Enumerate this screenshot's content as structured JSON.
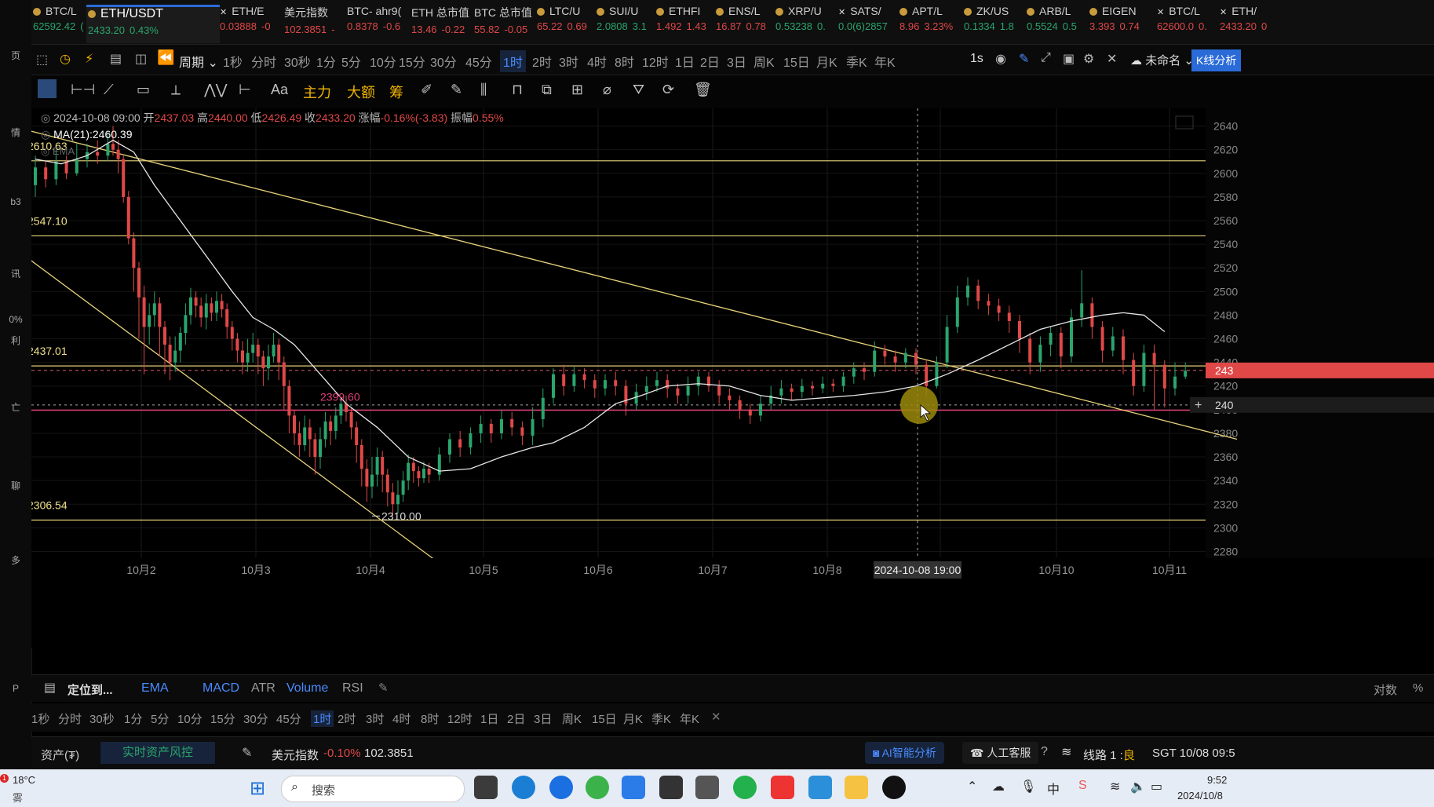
{
  "left_strip": [
    {
      "label": "页",
      "y": 62
    },
    {
      "label": "情",
      "y": 160
    },
    {
      "label": "b3",
      "y": 250
    },
    {
      "label": "讯",
      "y": 340
    },
    {
      "label": "0%",
      "y": 400
    },
    {
      "label": "利",
      "y": 425
    },
    {
      "label": "亡",
      "y": 510
    },
    {
      "label": "聊",
      "y": 610
    },
    {
      "label": "多",
      "y": 705
    },
    {
      "label": "P",
      "y": 870
    }
  ],
  "tickers": [
    {
      "name": "BTC/L",
      "price": "62592.42",
      "change": "(",
      "color": "#2aa56d",
      "icon": "coin-icon"
    },
    {
      "name": "ETH/USDT",
      "price": "2433.20",
      "change": "0.43%",
      "color": "#2aa56d",
      "icon": "coin-icon",
      "active": true
    },
    {
      "name": "ETH/E",
      "price": "0.03888",
      "change": "-0",
      "color": "#e04848",
      "icon": "close-icon"
    },
    {
      "name": "美元指数",
      "price": "102.3851",
      "change": "-",
      "color": "#e04848",
      "icon": ""
    },
    {
      "name": "BTC- ahr9(",
      "price": "0.8378",
      "change": "-0.6",
      "color": "#e04848",
      "icon": ""
    },
    {
      "name": "ETH 总市值",
      "price": "13.46",
      "change": "-0.22",
      "color": "#e04848",
      "icon": ""
    },
    {
      "name": "BTC 总市值",
      "price": "55.82",
      "change": "-0.05",
      "color": "#e04848",
      "icon": ""
    },
    {
      "name": "LTC/U",
      "price": "65.22",
      "change": "0.69",
      "color": "#e04848",
      "icon": "coin-icon"
    },
    {
      "name": "SUI/U",
      "price": "2.0808",
      "change": "3.1",
      "color": "#2aa56d",
      "icon": "coin-icon"
    },
    {
      "name": "ETHFI",
      "price": "1.492",
      "change": "1.43",
      "color": "#e04848",
      "icon": "coin-icon"
    },
    {
      "name": "ENS/L",
      "price": "16.87",
      "change": "0.78",
      "color": "#e04848",
      "icon": "coin-icon"
    },
    {
      "name": "XRP/U",
      "price": "0.53238",
      "change": "0.",
      "color": "#2aa56d",
      "icon": "xrp-icon"
    },
    {
      "name": "SATS/",
      "price": "0.0(6)2857",
      "change": "",
      "color": "#2aa56d",
      "icon": "close-icon"
    },
    {
      "name": "APT/L",
      "price": "8.96",
      "change": "3.23%",
      "color": "#e04848",
      "icon": "coin-icon"
    },
    {
      "name": "ZK/US",
      "price": "0.1334",
      "change": "1.8",
      "color": "#2aa56d",
      "icon": "coin-icon"
    },
    {
      "name": "ARB/L",
      "price": "0.5524",
      "change": "0.5",
      "color": "#2aa56d",
      "icon": "coin-icon"
    },
    {
      "name": "EIGEN",
      "price": "3.393",
      "change": "0.74",
      "color": "#e04848",
      "icon": "coin-icon"
    },
    {
      "name": "BTC/L",
      "price": "62600.0",
      "change": "0.",
      "color": "#e04848",
      "icon": "close-icon"
    },
    {
      "name": "ETH/",
      "price": "2433.20",
      "change": "0",
      "color": "#e04848",
      "icon": "close-icon"
    }
  ],
  "period_bar": {
    "cycle_label": "周期",
    "periods": [
      "1秒",
      "分时",
      "30秒",
      "1分",
      "5分",
      "10分",
      "15分",
      "30分",
      "45分",
      "1时",
      "2时",
      "3时",
      "4时",
      "8时",
      "12时",
      "1日",
      "2日",
      "3日",
      "周K",
      "15日",
      "月K",
      "季K",
      "年K"
    ],
    "selected": "1时",
    "interval": "1s",
    "workspace": "未命名",
    "k_analysis": "K线分析"
  },
  "draw_bar": {
    "text_tool": "Aa",
    "main": "主力",
    "big": "大额",
    "chip": "筹"
  },
  "info": {
    "date": "2024-10-08 09:00",
    "open_label": "开",
    "open": "2437.03",
    "high_label": "高",
    "high": "2440.00",
    "low_label": "低",
    "low": "2426.49",
    "close_label": "收",
    "close": "2433.20",
    "change_label": "涨幅",
    "change": "-0.16%(-3.83)",
    "amp_label": "振幅",
    "amp": "0.55%",
    "ma_label": "MA(21):2460.39",
    "ema_label": "EMA"
  },
  "chart_data": {
    "type": "candlestick",
    "x_ticks": [
      "10月2",
      "10月3",
      "10月4",
      "10月5",
      "10月6",
      "10月7",
      "10月8",
      "10月10",
      "10月11"
    ],
    "y_ticks": [
      2640,
      2620,
      2600,
      2580,
      2560,
      2540,
      2520,
      2500,
      2480,
      2460,
      2440,
      2420,
      2400,
      2380,
      2360,
      2340,
      2320,
      2300,
      2280
    ],
    "ylim": [
      2270,
      2655
    ],
    "crosshair_label": "2024-10-08 19:00",
    "current_price_tag": "243",
    "crosshair_price_tag": "240",
    "levels": [
      {
        "value": 2610.63,
        "label": "2610.63"
      },
      {
        "value": 2547.1,
        "label": "2547.10"
      },
      {
        "value": 2437.01,
        "label": "2437.01"
      },
      {
        "value": 2306.54,
        "label": "2306.54"
      }
    ],
    "pink_level": {
      "value": 2399.6,
      "label": "2399.60"
    },
    "low_marker": {
      "value": 2310.0,
      "label": "2310.00"
    },
    "ma_points": [
      [
        0,
        2612
      ],
      [
        5,
        2608
      ],
      [
        10,
        2615
      ],
      [
        15,
        2628
      ],
      [
        19,
        2618
      ],
      [
        23,
        2590
      ],
      [
        28,
        2560
      ],
      [
        33,
        2530
      ],
      [
        38,
        2500
      ],
      [
        42,
        2478
      ],
      [
        46,
        2468
      ],
      [
        50,
        2455
      ],
      [
        55,
        2430
      ],
      [
        60,
        2405
      ],
      [
        66,
        2385
      ],
      [
        72,
        2360
      ],
      [
        78,
        2348
      ],
      [
        84,
        2350
      ],
      [
        90,
        2360
      ],
      [
        96,
        2368
      ],
      [
        100,
        2372
      ],
      [
        106,
        2385
      ],
      [
        112,
        2405
      ],
      [
        117,
        2412
      ],
      [
        122,
        2420
      ],
      [
        128,
        2422
      ],
      [
        134,
        2420
      ],
      [
        140,
        2412
      ],
      [
        146,
        2408
      ],
      [
        152,
        2410
      ],
      [
        158,
        2412
      ],
      [
        164,
        2415
      ],
      [
        170,
        2420
      ],
      [
        176,
        2430
      ],
      [
        182,
        2442
      ],
      [
        188,
        2455
      ],
      [
        194,
        2468
      ],
      [
        200,
        2475
      ],
      [
        206,
        2480
      ],
      [
        210,
        2482
      ],
      [
        214,
        2480
      ],
      [
        218,
        2466
      ]
    ],
    "candles": [
      [
        0,
        2590,
        2605,
        2615,
        2580
      ],
      [
        2,
        2605,
        2595,
        2610,
        2588
      ],
      [
        4,
        2595,
        2610,
        2620,
        2590
      ],
      [
        6,
        2610,
        2600,
        2615,
        2595
      ],
      [
        8,
        2600,
        2612,
        2625,
        2598
      ],
      [
        10,
        2612,
        2618,
        2625,
        2605
      ],
      [
        12,
        2618,
        2615,
        2628,
        2608
      ],
      [
        14,
        2615,
        2625,
        2635,
        2610
      ],
      [
        15,
        2625,
        2620,
        2640,
        2615
      ],
      [
        16,
        2620,
        2612,
        2628,
        2600
      ],
      [
        17,
        2612,
        2580,
        2615,
        2575
      ],
      [
        18,
        2580,
        2545,
        2585,
        2540
      ],
      [
        19,
        2545,
        2520,
        2550,
        2500
      ],
      [
        20,
        2520,
        2495,
        2525,
        2460
      ],
      [
        21,
        2495,
        2470,
        2505,
        2430
      ],
      [
        22,
        2470,
        2480,
        2490,
        2455
      ],
      [
        23,
        2480,
        2490,
        2500,
        2470
      ],
      [
        24,
        2490,
        2470,
        2495,
        2445
      ],
      [
        25,
        2470,
        2455,
        2475,
        2430
      ],
      [
        26,
        2455,
        2440,
        2462,
        2425
      ],
      [
        27,
        2440,
        2450,
        2462,
        2432
      ],
      [
        28,
        2450,
        2465,
        2470,
        2440
      ],
      [
        29,
        2465,
        2480,
        2490,
        2455
      ],
      [
        30,
        2480,
        2495,
        2503,
        2472
      ],
      [
        31,
        2495,
        2488,
        2500,
        2478
      ],
      [
        32,
        2488,
        2478,
        2495,
        2470
      ],
      [
        33,
        2478,
        2490,
        2498,
        2468
      ],
      [
        34,
        2490,
        2482,
        2495,
        2475
      ],
      [
        35,
        2482,
        2492,
        2500,
        2475
      ],
      [
        36,
        2492,
        2485,
        2498,
        2478
      ],
      [
        37,
        2485,
        2470,
        2490,
        2460
      ],
      [
        38,
        2470,
        2460,
        2475,
        2450
      ],
      [
        39,
        2460,
        2450,
        2465,
        2440
      ],
      [
        40,
        2450,
        2440,
        2458,
        2430
      ],
      [
        41,
        2440,
        2448,
        2460,
        2432
      ],
      [
        42,
        2448,
        2455,
        2465,
        2440
      ],
      [
        43,
        2455,
        2445,
        2460,
        2430
      ],
      [
        44,
        2445,
        2435,
        2450,
        2420
      ],
      [
        45,
        2435,
        2445,
        2455,
        2425
      ],
      [
        46,
        2445,
        2455,
        2465,
        2440
      ],
      [
        47,
        2455,
        2440,
        2460,
        2425
      ],
      [
        48,
        2440,
        2420,
        2445,
        2400
      ],
      [
        49,
        2420,
        2395,
        2425,
        2380
      ],
      [
        50,
        2395,
        2380,
        2400,
        2370
      ],
      [
        51,
        2380,
        2370,
        2390,
        2360
      ],
      [
        52,
        2370,
        2385,
        2395,
        2365
      ],
      [
        53,
        2385,
        2375,
        2392,
        2360
      ],
      [
        54,
        2375,
        2360,
        2380,
        2345
      ],
      [
        55,
        2360,
        2375,
        2385,
        2350
      ],
      [
        56,
        2375,
        2390,
        2398,
        2368
      ],
      [
        57,
        2390,
        2382,
        2395,
        2370
      ],
      [
        58,
        2382,
        2395,
        2402,
        2375
      ],
      [
        59,
        2395,
        2405,
        2410,
        2388
      ],
      [
        60,
        2405,
        2398,
        2412,
        2390
      ],
      [
        61,
        2398,
        2385,
        2402,
        2375
      ],
      [
        62,
        2385,
        2370,
        2390,
        2355
      ],
      [
        63,
        2370,
        2350,
        2375,
        2335
      ],
      [
        64,
        2350,
        2335,
        2358,
        2322
      ],
      [
        65,
        2335,
        2345,
        2360,
        2325
      ],
      [
        66,
        2345,
        2360,
        2368,
        2335
      ],
      [
        67,
        2360,
        2345,
        2365,
        2330
      ],
      [
        68,
        2345,
        2330,
        2350,
        2318
      ],
      [
        69,
        2330,
        2320,
        2338,
        2310
      ],
      [
        70,
        2320,
        2328,
        2340,
        2312
      ],
      [
        71,
        2328,
        2340,
        2348,
        2322
      ],
      [
        72,
        2340,
        2355,
        2362,
        2332
      ],
      [
        73,
        2355,
        2348,
        2360,
        2338
      ],
      [
        74,
        2348,
        2342,
        2352,
        2335
      ],
      [
        75,
        2342,
        2350,
        2356,
        2338
      ],
      [
        76,
        2350,
        2345,
        2355,
        2338
      ],
      [
        78,
        2345,
        2362,
        2368,
        2340
      ],
      [
        80,
        2362,
        2375,
        2380,
        2355
      ],
      [
        82,
        2375,
        2368,
        2382,
        2360
      ],
      [
        84,
        2368,
        2380,
        2385,
        2362
      ],
      [
        86,
        2380,
        2388,
        2395,
        2372
      ],
      [
        88,
        2388,
        2380,
        2392,
        2372
      ],
      [
        90,
        2380,
        2392,
        2400,
        2375
      ],
      [
        92,
        2392,
        2385,
        2398,
        2378
      ],
      [
        94,
        2385,
        2378,
        2390,
        2370
      ],
      [
        96,
        2378,
        2392,
        2402,
        2370
      ],
      [
        98,
        2392,
        2410,
        2418,
        2385
      ],
      [
        100,
        2410,
        2430,
        2435,
        2405
      ],
      [
        102,
        2430,
        2420,
        2438,
        2412
      ],
      [
        104,
        2420,
        2430,
        2436,
        2415
      ],
      [
        106,
        2430,
        2425,
        2435,
        2418
      ],
      [
        108,
        2425,
        2418,
        2430,
        2410
      ],
      [
        110,
        2418,
        2425,
        2430,
        2412
      ],
      [
        112,
        2425,
        2420,
        2432,
        2412
      ],
      [
        114,
        2420,
        2405,
        2425,
        2395
      ],
      [
        116,
        2405,
        2415,
        2422,
        2400
      ],
      [
        118,
        2415,
        2420,
        2428,
        2408
      ],
      [
        120,
        2420,
        2425,
        2432,
        2415
      ],
      [
        122,
        2425,
        2418,
        2430,
        2410
      ],
      [
        124,
        2418,
        2412,
        2422,
        2405
      ],
      [
        126,
        2412,
        2420,
        2428,
        2405
      ],
      [
        128,
        2420,
        2428,
        2432,
        2412
      ],
      [
        130,
        2428,
        2420,
        2432,
        2415
      ],
      [
        132,
        2420,
        2412,
        2425,
        2405
      ],
      [
        134,
        2412,
        2408,
        2418,
        2400
      ],
      [
        136,
        2408,
        2400,
        2412,
        2392
      ],
      [
        138,
        2400,
        2395,
        2405,
        2388
      ],
      [
        140,
        2395,
        2405,
        2412,
        2390
      ],
      [
        142,
        2405,
        2412,
        2420,
        2400
      ],
      [
        144,
        2412,
        2418,
        2425,
        2405
      ],
      [
        146,
        2418,
        2415,
        2422,
        2408
      ],
      [
        148,
        2415,
        2420,
        2426,
        2410
      ],
      [
        150,
        2420,
        2418,
        2424,
        2412
      ],
      [
        152,
        2418,
        2422,
        2428,
        2414
      ],
      [
        154,
        2422,
        2420,
        2426,
        2415
      ],
      [
        156,
        2420,
        2428,
        2432,
        2415
      ],
      [
        158,
        2428,
        2435,
        2440,
        2422
      ],
      [
        160,
        2435,
        2432,
        2440,
        2425
      ],
      [
        162,
        2432,
        2450,
        2458,
        2428
      ],
      [
        164,
        2450,
        2445,
        2455,
        2438
      ],
      [
        166,
        2445,
        2440,
        2450,
        2432
      ],
      [
        168,
        2440,
        2448,
        2452,
        2435
      ],
      [
        170,
        2448,
        2438,
        2452,
        2430
      ],
      [
        172,
        2438,
        2420,
        2442,
        2412
      ],
      [
        174,
        2420,
        2440,
        2445,
        2418
      ],
      [
        176,
        2440,
        2470,
        2480,
        2435
      ],
      [
        178,
        2470,
        2495,
        2505,
        2465
      ],
      [
        180,
        2495,
        2505,
        2512,
        2488
      ],
      [
        182,
        2505,
        2492,
        2510,
        2485
      ],
      [
        184,
        2492,
        2488,
        2498,
        2480
      ],
      [
        186,
        2488,
        2482,
        2494,
        2475
      ],
      [
        188,
        2482,
        2475,
        2488,
        2465
      ],
      [
        190,
        2475,
        2460,
        2480,
        2448
      ],
      [
        192,
        2460,
        2440,
        2465,
        2430
      ],
      [
        194,
        2440,
        2455,
        2462,
        2432
      ],
      [
        196,
        2455,
        2465,
        2470,
        2445
      ],
      [
        198,
        2465,
        2445,
        2470,
        2435
      ],
      [
        200,
        2445,
        2478,
        2485,
        2440
      ],
      [
        202,
        2478,
        2490,
        2518,
        2470
      ],
      [
        204,
        2490,
        2470,
        2495,
        2460
      ],
      [
        206,
        2470,
        2450,
        2475,
        2440
      ],
      [
        208,
        2450,
        2462,
        2470,
        2445
      ],
      [
        210,
        2462,
        2442,
        2468,
        2430
      ],
      [
        212,
        2442,
        2420,
        2448,
        2412
      ],
      [
        214,
        2420,
        2448,
        2455,
        2415
      ],
      [
        216,
        2448,
        2438,
        2455,
        2400
      ],
      [
        218,
        2438,
        2418,
        2442,
        2402
      ],
      [
        220,
        2418,
        2428,
        2440,
        2412
      ],
      [
        222,
        2428,
        2433,
        2440,
        2426
      ]
    ]
  },
  "indicator_bar": {
    "locate": "定位到...",
    "items": [
      "EMA",
      "MACD",
      "ATR",
      "Volume",
      "RSI"
    ],
    "right_log": "对数",
    "right_pct": "%"
  },
  "period2": [
    "1秒",
    "分时",
    "30秒",
    "1分",
    "5分",
    "10分",
    "15分",
    "30分",
    "45分",
    "1时",
    "2时",
    "3时",
    "4时",
    "8时",
    "12时",
    "1日",
    "2日",
    "3日",
    "周K",
    "15日",
    "月K",
    "季K",
    "年K"
  ],
  "period2_selected": "1时",
  "status": {
    "assets": "资产(₮)",
    "risk": "实时资产风控",
    "index_name": "美元指数",
    "index_change": "-0.10%",
    "index_value": "102.3851",
    "ai": "AI智能分析",
    "service": "人工客服",
    "line": "线路 1 :",
    "line_quality": "良",
    "time": "SGT 10/08 09:5"
  },
  "taskbar": {
    "temp": "18°C",
    "weather": "雾",
    "badge": "1",
    "search": "搜索",
    "time": "9:52",
    "date": "2024/10/8"
  }
}
